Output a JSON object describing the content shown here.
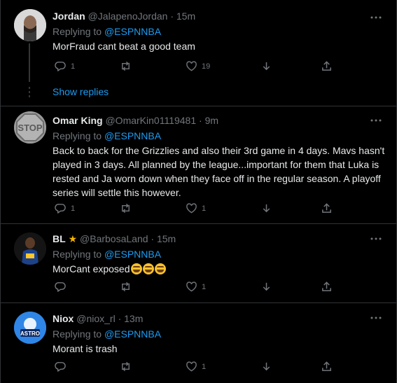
{
  "tweets": [
    {
      "name": "Jordan",
      "handle": "@JalapenoJordan",
      "time": "15m",
      "replying_label": "Replying to",
      "replying_to": "@ESPNNBA",
      "text": "MorFraud cant beat a good team",
      "replies": "1",
      "retweets": "",
      "likes": "19",
      "show_replies": "Show replies",
      "avatar_icon": "bald-man-avatar"
    },
    {
      "name": "Omar King",
      "handle": "@OmarKin01119481",
      "time": "9m",
      "replying_label": "Replying to",
      "replying_to": "@ESPNNBA",
      "text": "Back to back for the Grizzlies and also their 3rd game in 4 days. Mavs hasn't played in 3 days. All planned by the league...important for them that Luka is rested and Ja worn down when they face off in the regular season. A playoff series will settle this however.",
      "replies": "1",
      "retweets": "",
      "likes": "1",
      "avatar_text": "STOP"
    },
    {
      "name": "BL",
      "handle": "@BarbosaLand",
      "time": "15m",
      "replying_label": "Replying to",
      "replying_to": "@ESPNNBA",
      "text": "MorCant exposed",
      "replies": "",
      "retweets": "",
      "likes": "1",
      "badge_icon": "star-icon",
      "emoji_icon": "joy-emoji"
    },
    {
      "name": "Niox",
      "handle": "@niox_rl",
      "time": "13m",
      "replying_label": "Replying to",
      "replying_to": "@ESPNNBA",
      "text": "Morant is trash",
      "replies": "",
      "retweets": "",
      "likes": "1",
      "avatar_text": "ASTRO"
    }
  ],
  "separator": "·",
  "colors": {
    "background": "#000000",
    "link": "#1d9bf0",
    "muted": "#71767b",
    "text": "#e7e9ea",
    "divider": "#2f3336"
  }
}
